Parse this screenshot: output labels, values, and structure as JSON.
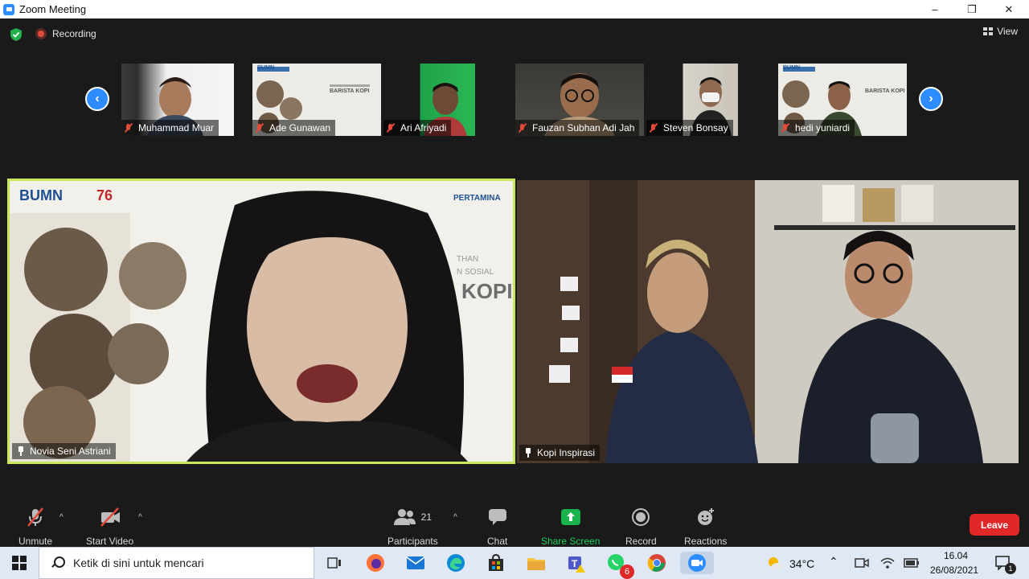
{
  "window": {
    "title": "Zoom Meeting",
    "minimize": "–",
    "restore": "❐",
    "close": "✕"
  },
  "topbar": {
    "recording_label": "Recording",
    "view_label": "View"
  },
  "thumbnails": [
    {
      "name": "Muhammad Muar"
    },
    {
      "name": "Ade Gunawan"
    },
    {
      "name": "Ari Afriyadi"
    },
    {
      "name": "Fauzan Subhan Adi Jah"
    },
    {
      "name": "Steven Bonsay"
    },
    {
      "name": "hedi yuniardi"
    }
  ],
  "thumb_overlay": {
    "title": "BARISTA KOPI",
    "brand": "BUMN"
  },
  "main_videos": [
    {
      "name": "Novia Seni Astriani",
      "bg_brand": "PERTAMINA",
      "bg_logo": "BUMN",
      "bg_word": "KOPI",
      "bg_line1": "THAN",
      "bg_line2": "N SOSIAL",
      "anniv": "76"
    },
    {
      "name": "Kopi Inspirasi"
    }
  ],
  "toolbar": {
    "unmute": "Unmute",
    "start_video": "Start Video",
    "participants": "Participants",
    "participants_count": "21",
    "chat": "Chat",
    "share_screen": "Share Screen",
    "record": "Record",
    "reactions": "Reactions",
    "leave": "Leave"
  },
  "taskbar": {
    "search_placeholder": "Ketik di sini untuk mencari",
    "whatsapp_badge": "6",
    "temperature": "34°C",
    "time": "16.04",
    "date": "26/08/2021",
    "notification_count": "1"
  },
  "colors": {
    "zoom_blue": "#2d8cff",
    "active_speaker": "#c8e85a",
    "leave_red": "#e02828",
    "share_green": "#1ab34b",
    "muted_red": "#e24a3a"
  }
}
